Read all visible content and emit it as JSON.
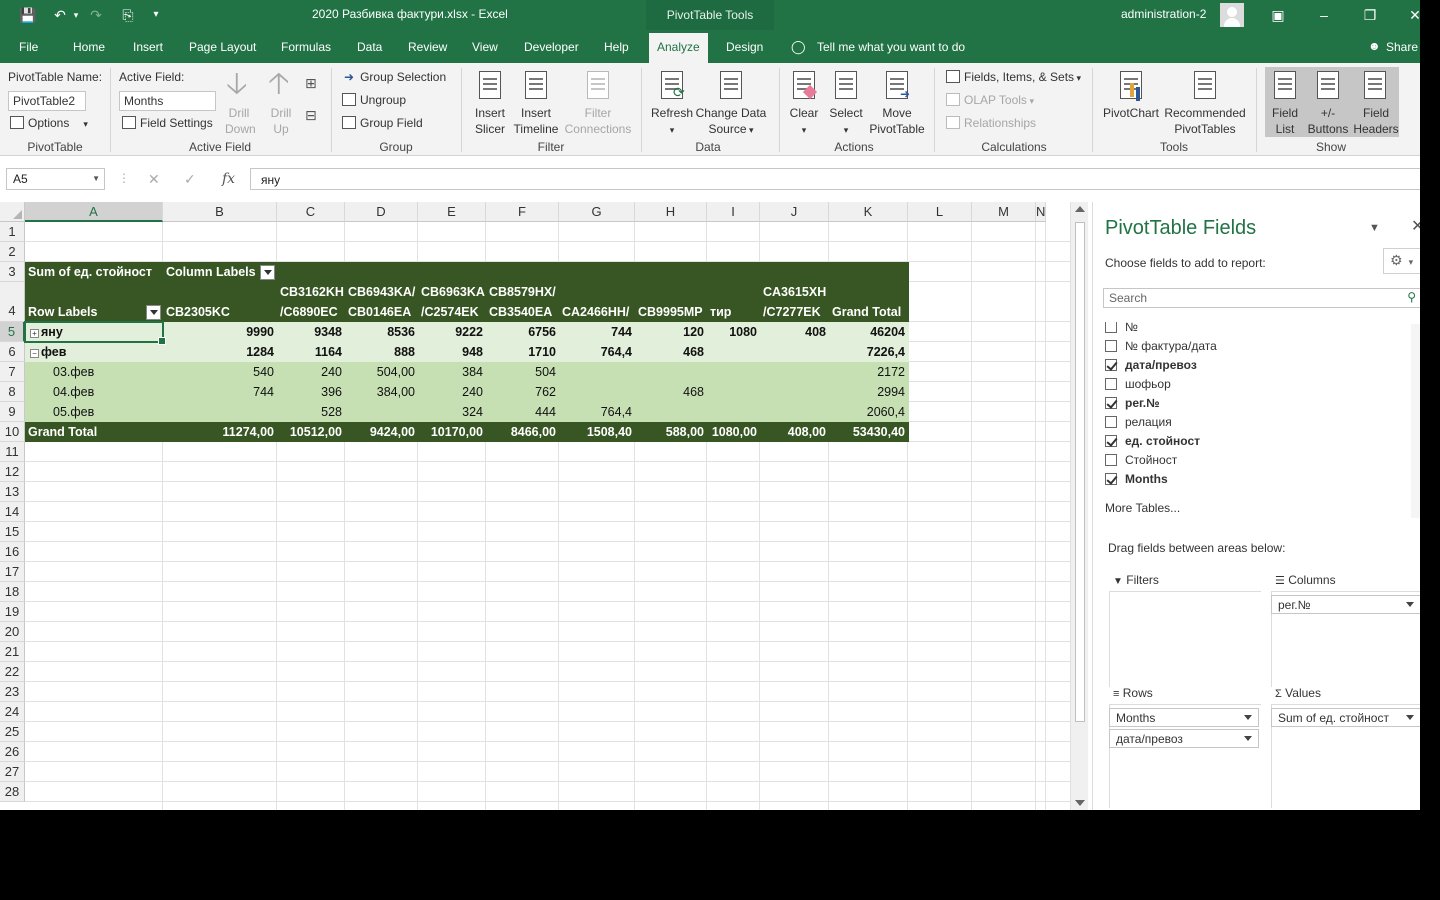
{
  "window": {
    "title": "2020 Разбивка фактури.xlsx  -  Excel",
    "tools_tab": "PivotTable Tools",
    "user": "administration-2",
    "accent": "#217346"
  },
  "tabs": [
    "File",
    "Home",
    "Insert",
    "Page Layout",
    "Formulas",
    "Data",
    "Review",
    "View",
    "Developer",
    "Help",
    "Analyze",
    "Design"
  ],
  "tell_me": "Tell me what you want to do",
  "share": "Share",
  "ribbon": {
    "pivottable": {
      "name_label": "PivotTable Name:",
      "name_value": "PivotTable2",
      "options": "Options",
      "group": "PivotTable"
    },
    "active_field": {
      "label": "Active Field:",
      "value": "Months",
      "field_settings": "Field Settings",
      "drill_down": [
        "Drill",
        "Down"
      ],
      "drill_up": [
        "Drill",
        "Up"
      ],
      "group": "Active Field"
    },
    "group": {
      "group_selection": "Group Selection",
      "ungroup": "Ungroup",
      "group_field": "Group Field",
      "group": "Group"
    },
    "filter": {
      "insert_slicer": [
        "Insert",
        "Slicer"
      ],
      "insert_timeline": [
        "Insert",
        "Timeline"
      ],
      "filter_connections": [
        "Filter",
        "Connections"
      ],
      "group": "Filter"
    },
    "data": {
      "refresh": "Refresh",
      "change_source": [
        "Change Data",
        "Source"
      ],
      "group": "Data"
    },
    "actions": {
      "clear": "Clear",
      "select": "Select",
      "move": [
        "Move",
        "PivotTable"
      ],
      "group": "Actions"
    },
    "calculations": {
      "fields_items_sets": "Fields, Items, & Sets",
      "olap_tools": "OLAP Tools",
      "relationships": "Relationships",
      "group": "Calculations"
    },
    "tools": {
      "pivotchart": "PivotChart",
      "recommended": [
        "Recommended",
        "PivotTables"
      ],
      "group": "Tools"
    },
    "show": {
      "field_list": [
        "Field",
        "List"
      ],
      "buttons": [
        "+/-",
        "Buttons"
      ],
      "field_headers": [
        "Field",
        "Headers"
      ],
      "group": "Show"
    }
  },
  "formula_bar": {
    "name_box": "A5",
    "formula": "яну"
  },
  "columns": [
    "A",
    "B",
    "C",
    "D",
    "E",
    "F",
    "G",
    "H",
    "I",
    "J",
    "K",
    "L",
    "M",
    "N"
  ],
  "rows": [
    "1",
    "2",
    "3",
    "4",
    "5",
    "6",
    "7",
    "8",
    "9",
    "10",
    "11",
    "12",
    "13",
    "14",
    "15",
    "16",
    "17",
    "18",
    "19",
    "20",
    "21",
    "22",
    "23",
    "24",
    "25",
    "26",
    "27",
    "28"
  ],
  "pivot": {
    "value_label": "Sum of ед. стойност",
    "column_labels": "Column Labels",
    "row_labels": "Row Labels",
    "headers": [
      {
        "l1": "",
        "l2": "CB2305KC"
      },
      {
        "l1": "CB3162KH",
        "l2": "/C6890EC"
      },
      {
        "l1": "CB6943KA/",
        "l2": "CB0146EA"
      },
      {
        "l1": "CB6963KA",
        "l2": "/C2574EK"
      },
      {
        "l1": "CB8579HX/",
        "l2": "CB3540EA"
      },
      {
        "l1": "",
        "l2": "CA2466HH/"
      },
      {
        "l1": "",
        "l2": "CB9995MP"
      },
      {
        "l1": "",
        "l2": "тир"
      },
      {
        "l1": "CA3615XH",
        "l2": "/C7277EK"
      },
      {
        "l1": "",
        "l2": "Grand Total"
      }
    ],
    "data_rows": [
      {
        "label": "яну",
        "toggle": "+",
        "cells": [
          "9990",
          "9348",
          "8536",
          "9222",
          "6756",
          "744",
          "120",
          "1080",
          "408",
          "46204"
        ]
      },
      {
        "label": "фев",
        "toggle": "−",
        "cells": [
          "1284",
          "1164",
          "888",
          "948",
          "1710",
          "764,4",
          "468",
          "",
          "",
          "7226,4"
        ]
      },
      {
        "label": "03.фев",
        "toggle": "",
        "cells": [
          "540",
          "240",
          "504,00",
          "384",
          "504",
          "",
          "",
          "",
          "",
          "2172"
        ]
      },
      {
        "label": "04.фев",
        "toggle": "",
        "cells": [
          "744",
          "396",
          "384,00",
          "240",
          "762",
          "",
          "468",
          "",
          "",
          "2994"
        ]
      },
      {
        "label": "05.фев",
        "toggle": "",
        "cells": [
          "",
          "528",
          "",
          "324",
          "444",
          "764,4",
          "",
          "",
          "",
          "2060,4"
        ]
      }
    ],
    "grand_total": {
      "label": "Grand Total",
      "cells": [
        "11274,00",
        "10512,00",
        "9424,00",
        "10170,00",
        "8466,00",
        "1508,40",
        "588,00",
        "1080,00",
        "408,00",
        "53430,40"
      ]
    }
  },
  "pane": {
    "title": "PivotTable Fields",
    "choose": "Choose fields to add to report:",
    "search_placeholder": "Search",
    "fields": [
      {
        "name": "№",
        "checked": false
      },
      {
        "name": "№ фактура/дата",
        "checked": false
      },
      {
        "name": "дата/превоз",
        "checked": true
      },
      {
        "name": "шофьор",
        "checked": false
      },
      {
        "name": "рег.№",
        "checked": true
      },
      {
        "name": "релация",
        "checked": false
      },
      {
        "name": "ед. стойност",
        "checked": true
      },
      {
        "name": "Стойност",
        "checked": false
      },
      {
        "name": "Months",
        "checked": true
      }
    ],
    "more_tables": "More Tables...",
    "drag_text": "Drag fields between areas below:",
    "areas": {
      "filters": {
        "title": "Filters",
        "items": []
      },
      "columns": {
        "title": "Columns",
        "items": [
          "рег.№"
        ]
      },
      "rows": {
        "title": "Rows",
        "items": [
          "Months",
          "дата/превоз"
        ]
      },
      "values": {
        "title": "Values",
        "items": [
          "Sum of ед. стойност"
        ]
      }
    }
  }
}
